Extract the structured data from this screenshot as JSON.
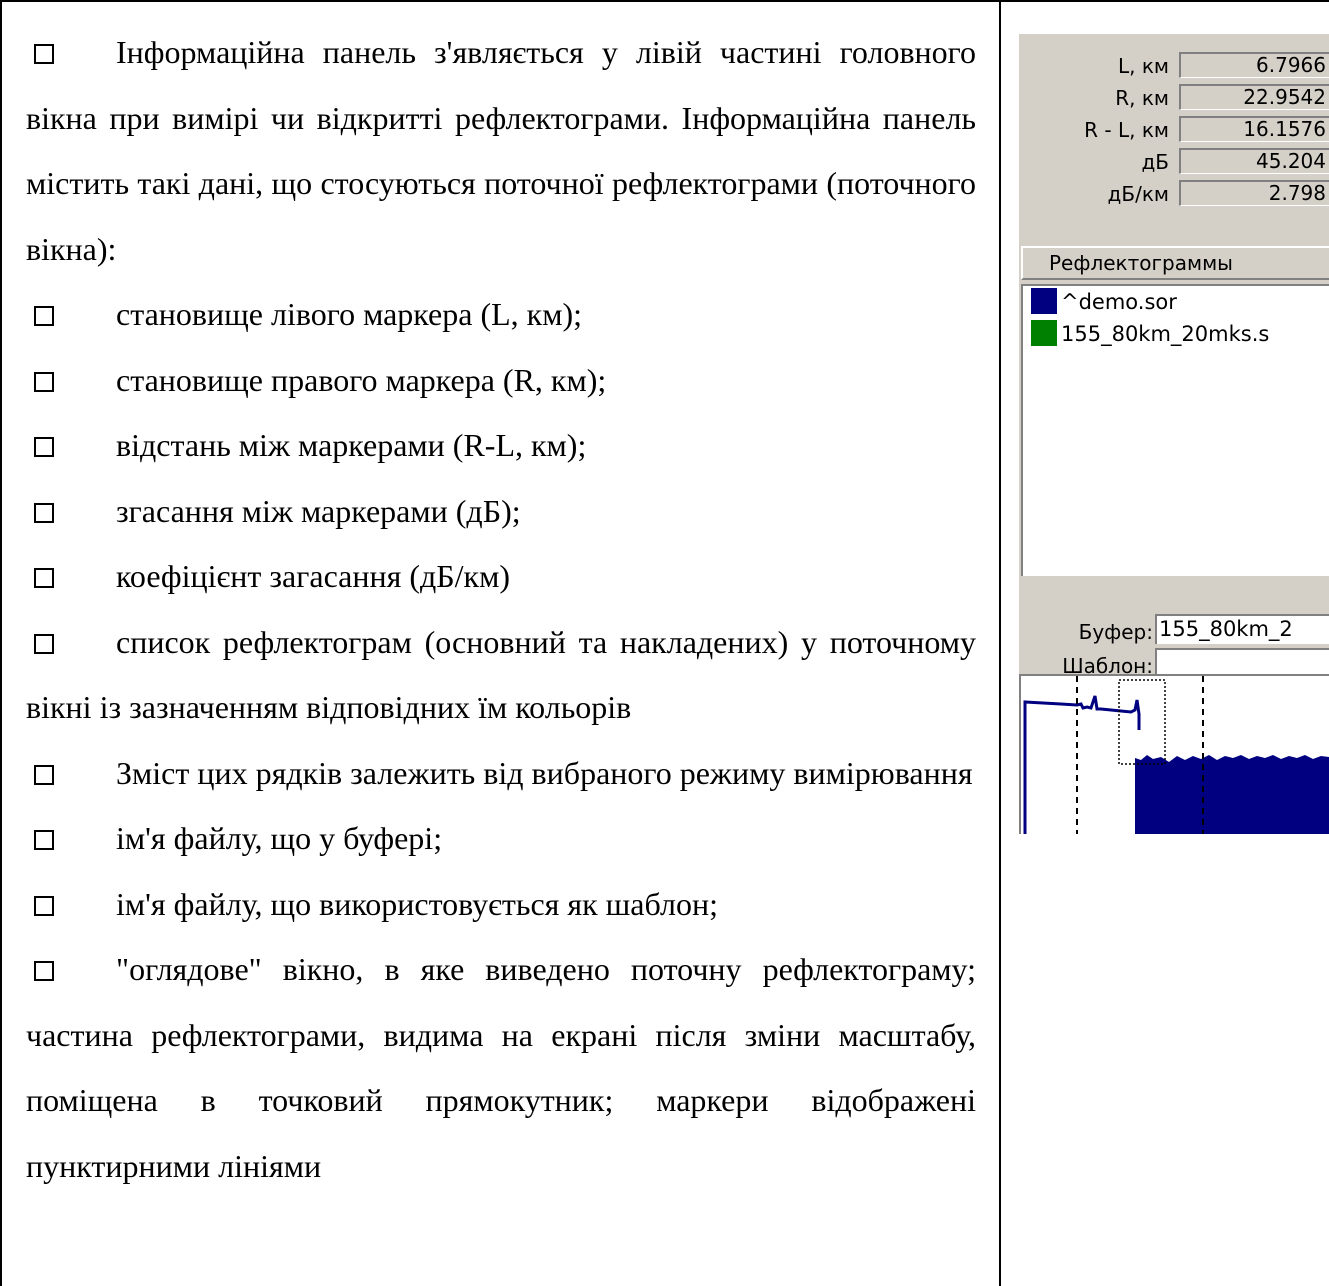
{
  "left_column": {
    "items": [
      "Інформаційна панель з'являється у лівій частині головного вікна при вимірі чи відкритті рефлектограми. Інформаційна панель містить такі дані, що стосуються поточної рефлектограми (поточного вікна):",
      "становище лівого маркера (L, км);",
      "становище правого маркера (R, км);",
      "відстань між маркерами (R-L, км);",
      "згасання між маркерами (дБ);",
      "коефіцієнт загасання (дБ/км)",
      "список рефлектограм (основний та накладених) у поточному вікні із зазначенням відповідних їм кольорів",
      "Зміст цих рядків залежить від вибраного режиму вимірювання",
      "ім'я файлу, що у буфері;",
      "ім'я файлу, що використовується як шаблон;",
      "\"оглядове\" вікно, в яке виведено поточну рефлектограму; частина рефлектограми, видима на екрані після зміни масштабу, поміщена в точковий прямокутник; маркери відображені пунктирними лініями"
    ]
  },
  "info_panel": {
    "measurements": [
      {
        "label": "L, км",
        "value": "6.7966"
      },
      {
        "label": "R, км",
        "value": "22.9542"
      },
      {
        "label": "R - L, км",
        "value": "16.1576"
      },
      {
        "label": "дБ",
        "value": "45.204"
      },
      {
        "label": "дБ/км",
        "value": "2.798"
      }
    ],
    "reflectograms_header": "Рефлектограммы",
    "reflectograms": [
      {
        "name": "^demo.sor",
        "color": "#000080"
      },
      {
        "name": "155_80km_20mks.s",
        "color": "#008000"
      }
    ],
    "buffer_label": "Буфер:",
    "buffer_value": "155_80km_2",
    "template_label": "Шаблон:",
    "template_value": "",
    "trace_color": "#000080"
  }
}
